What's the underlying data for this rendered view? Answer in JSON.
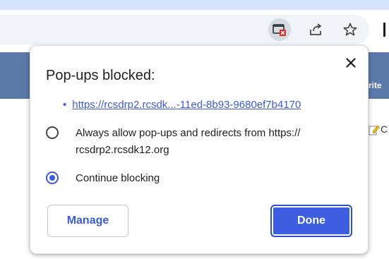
{
  "dialog": {
    "title": "Pop-ups blocked:",
    "blocked_link": "https://rcsdrp2.rcsdk...-11ed-8b93-9680ef7b4170",
    "link_bullet": "•",
    "options": [
      {
        "label": "Always allow pop-ups and redirects from https:// rcsdrp2.rcsdk12.org",
        "checked": false
      },
      {
        "label": "Continue blocking",
        "checked": true
      }
    ],
    "manage_label": "Manage",
    "done_label": "Done",
    "close_glyph": "✕"
  },
  "page": {
    "band_text": "rite",
    "edit_letter": "C"
  },
  "icons": {
    "toolbar": [
      "popup-blocked-icon",
      "share-icon",
      "bookmark-star-icon"
    ],
    "dialog": [
      "close-icon"
    ],
    "page": [
      "edit-icon"
    ]
  },
  "colors": {
    "accent": "#3b5bdb",
    "done_button": "#3d5ee0",
    "page_band": "#5b79a8",
    "omnibox": "#f0f4f9",
    "blocked_badge": "#d93025"
  }
}
